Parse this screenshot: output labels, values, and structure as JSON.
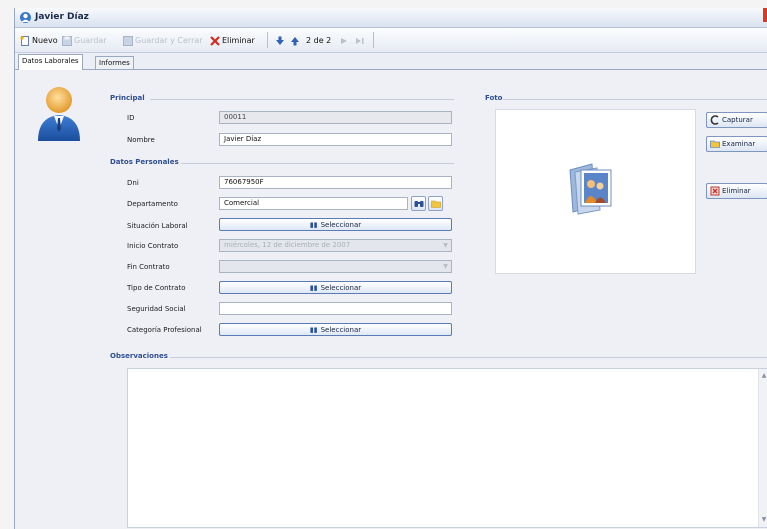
{
  "window": {
    "title": "Javier Díaz",
    "accent_color": "#2f4f93"
  },
  "toolbar": {
    "nuevo": "Nuevo",
    "guardar": "Guardar",
    "guardar_cerrar": "Guardar y Cerrar",
    "eliminar": "Eliminar",
    "record_position": "2 de 2"
  },
  "tabs": [
    {
      "label": "Datos Laborales",
      "active": true
    },
    {
      "label": "Informes",
      "active": false
    }
  ],
  "sections": {
    "principal": "Principal",
    "datos_personales": "Datos Personales",
    "observaciones": "Observaciones",
    "foto": "Foto"
  },
  "fields": {
    "id_label": "ID",
    "id_value": "00011",
    "nombre_label": "Nombre",
    "nombre_value": "Javier Díaz",
    "dni_label": "Dni",
    "dni_value": "76067950F",
    "departamento_label": "Departamento",
    "departamento_value": "Comercial",
    "situacion_label": "Situación Laboral",
    "inicio_label": "Inicio Contrato",
    "inicio_value": "miércoles, 12 de diciembre de 2007",
    "fin_label": "Fin Contrato",
    "fin_value": "",
    "tipo_label": "Tipo de Contrato",
    "seguridad_label": "Seguridad Social",
    "seguridad_value": "",
    "categoria_label": "Categoría Profesional"
  },
  "buttons": {
    "seleccionar": "Seleccionar",
    "capturar": "Capturar",
    "examinar": "Examinar",
    "eliminar": "Eliminar"
  },
  "observaciones_value": ""
}
